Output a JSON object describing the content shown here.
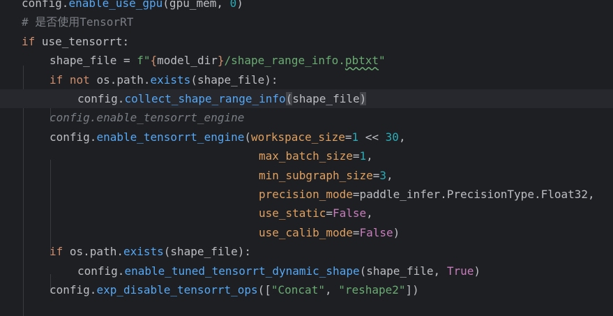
{
  "editor": {
    "lines": [
      {
        "tokens": [
          {
            "text": "config",
            "style": "t-id"
          },
          {
            "text": ".",
            "style": "t-id"
          },
          {
            "text": "enable_use_gpu",
            "style": "t-fn"
          },
          {
            "text": "(gpu_mem, ",
            "style": "t-id"
          },
          {
            "text": "0",
            "style": "t-num"
          },
          {
            "text": ")",
            "style": "t-id"
          }
        ]
      },
      {
        "tokens": [
          {
            "text": "# 是否使用TensorRT",
            "style": "t-cm"
          }
        ]
      },
      {
        "tokens": [
          {
            "text": "if",
            "style": "t-kw"
          },
          {
            "text": " use_tensorrt:",
            "style": "t-id"
          }
        ]
      },
      {
        "tokens": [
          {
            "text": "shape_file = ",
            "style": "t-id"
          },
          {
            "text": "f\"",
            "style": "t-str"
          },
          {
            "text": "{",
            "style": "t-kw"
          },
          {
            "text": "model_dir",
            "style": "t-id"
          },
          {
            "text": "}",
            "style": "t-kw"
          },
          {
            "text": "/shape_range_info.",
            "style": "t-str"
          },
          {
            "text": "pbtxt",
            "style": "t-str wavy"
          },
          {
            "text": "\"",
            "style": "t-str"
          }
        ]
      },
      {
        "tokens": [
          {
            "text": "if",
            "style": "t-kw"
          },
          {
            "text": " ",
            "style": "t-id"
          },
          {
            "text": "not",
            "style": "t-kw"
          },
          {
            "text": " os.path.",
            "style": "t-id"
          },
          {
            "text": "exists",
            "style": "t-fn"
          },
          {
            "text": "(shape_file):",
            "style": "t-id"
          }
        ]
      },
      {
        "tokens": [
          {
            "text": "config.",
            "style": "t-id"
          },
          {
            "text": "collect_shape_range_info",
            "style": "t-fn"
          },
          {
            "text": "(",
            "style": "t-bracket"
          },
          {
            "text": "shape_file",
            "style": "t-id"
          },
          {
            "text": ")",
            "style": "t-bracket"
          }
        ]
      },
      {
        "tokens": [
          {
            "text": "config.enable_tensorrt_engine",
            "style": "t-cm-it"
          }
        ]
      },
      {
        "tokens": [
          {
            "text": "config.",
            "style": "t-id"
          },
          {
            "text": "enable_tensorrt_engine",
            "style": "t-fn"
          },
          {
            "text": "(",
            "style": "t-id"
          },
          {
            "text": "workspace_size",
            "style": "t-param"
          },
          {
            "text": "=",
            "style": "t-id"
          },
          {
            "text": "1",
            "style": "t-num"
          },
          {
            "text": " << ",
            "style": "t-id"
          },
          {
            "text": "30",
            "style": "t-num"
          },
          {
            "text": ",",
            "style": "t-id"
          }
        ]
      },
      {
        "tokens": [
          {
            "text": "max_batch_size",
            "style": "t-param"
          },
          {
            "text": "=",
            "style": "t-id"
          },
          {
            "text": "1",
            "style": "t-num"
          },
          {
            "text": ",",
            "style": "t-id"
          }
        ]
      },
      {
        "tokens": [
          {
            "text": "min_subgraph_size",
            "style": "t-param"
          },
          {
            "text": "=",
            "style": "t-id"
          },
          {
            "text": "3",
            "style": "t-num"
          },
          {
            "text": ",",
            "style": "t-id"
          }
        ]
      },
      {
        "tokens": [
          {
            "text": "precision_mode",
            "style": "t-param"
          },
          {
            "text": "=paddle_infer.PrecisionType.Float32,",
            "style": "t-id"
          }
        ]
      },
      {
        "tokens": [
          {
            "text": "use_static",
            "style": "t-param"
          },
          {
            "text": "=",
            "style": "t-id"
          },
          {
            "text": "False",
            "style": "t-kwconst"
          },
          {
            "text": ",",
            "style": "t-id"
          }
        ]
      },
      {
        "tokens": [
          {
            "text": "use_calib_mode",
            "style": "t-param"
          },
          {
            "text": "=",
            "style": "t-id"
          },
          {
            "text": "False",
            "style": "t-kwconst"
          },
          {
            "text": ")",
            "style": "t-id"
          }
        ]
      },
      {
        "tokens": [
          {
            "text": "if",
            "style": "t-kw"
          },
          {
            "text": " os.path.",
            "style": "t-id"
          },
          {
            "text": "exists",
            "style": "t-fn"
          },
          {
            "text": "(shape_file):",
            "style": "t-id"
          }
        ]
      },
      {
        "tokens": [
          {
            "text": "config.",
            "style": "t-id"
          },
          {
            "text": "enable_tuned_tensorrt_dynamic_shape",
            "style": "t-fn"
          },
          {
            "text": "(shape_file, ",
            "style": "t-id"
          },
          {
            "text": "True",
            "style": "t-kwconst"
          },
          {
            "text": ")",
            "style": "t-id"
          }
        ]
      },
      {
        "tokens": [
          {
            "text": "config.",
            "style": "t-id"
          },
          {
            "text": "exp_disable_tensorrt_ops",
            "style": "t-fn"
          },
          {
            "text": "([",
            "style": "t-id"
          },
          {
            "text": "\"Concat\"",
            "style": "t-str"
          },
          {
            "text": ", ",
            "style": "t-id"
          },
          {
            "text": "\"reshape2\"",
            "style": "t-str"
          },
          {
            "text": "])",
            "style": "t-id"
          }
        ]
      }
    ]
  },
  "colors": {
    "background": "#1e1f22",
    "current_line": "#26282e",
    "keyword": "#cf8e6d",
    "function": "#56a8f5",
    "identifier": "#bcbec4",
    "number": "#2aacb8",
    "string": "#6aab73",
    "comment": "#7a7e85",
    "named_param": "#e0a060",
    "keyword_constant": "#c77dbb"
  }
}
